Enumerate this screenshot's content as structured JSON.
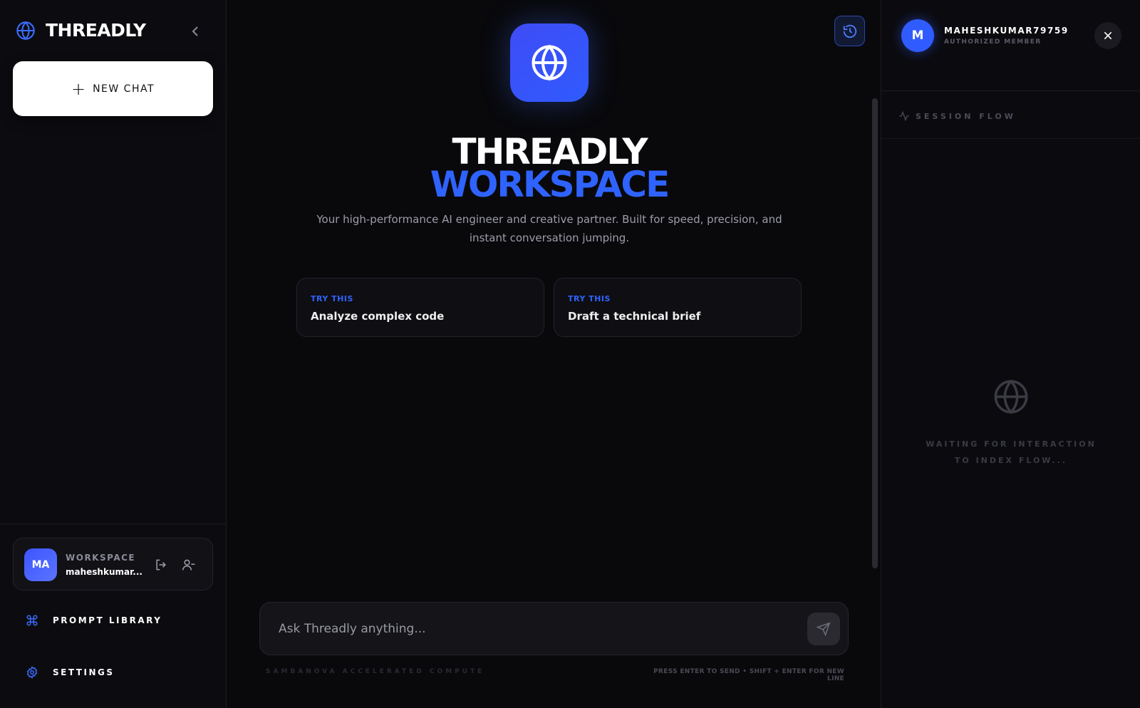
{
  "sidebar": {
    "brand_name": "THREADLY",
    "new_chat_label": "NEW CHAT",
    "workspace": {
      "avatar_initials": "MA",
      "title": "WORKSPACE",
      "user": "maheshkumar..."
    },
    "links": {
      "prompt_library": "PROMPT LIBRARY",
      "settings": "SETTINGS"
    }
  },
  "main": {
    "hero_title_line1": "THREADLY",
    "hero_title_line2": "WORKSPACE",
    "hero_subtitle": "Your high-performance AI engineer and creative partner. Built for speed, precision, and instant conversation jumping.",
    "suggestions": [
      {
        "tag": "TRY THIS",
        "text": "Analyze complex code"
      },
      {
        "tag": "TRY THIS",
        "text": "Draft a technical brief"
      }
    ],
    "composer": {
      "placeholder": "Ask Threadly anything...",
      "value": ""
    },
    "footer_left": "SAMBANOVA ACCELERATED COMPUTE",
    "footer_right": "PRESS ENTER TO SEND • SHIFT + ENTER FOR NEW LINE"
  },
  "right_panel": {
    "avatar_initial": "M",
    "username": "MAHESHKUMAR79759",
    "role": "AUTHORIZED MEMBER",
    "section_title": "SESSION FLOW",
    "empty_line1": "WAITING FOR INTERACTION",
    "empty_line2": "TO INDEX FLOW..."
  },
  "colors": {
    "accent": "#2f63ff",
    "background": "#09090c",
    "panel": "#0c0c10"
  },
  "icons": {
    "brand": "globe-icon",
    "collapse": "chevron-left-icon",
    "new_chat": "plus-icon",
    "logout": "logout-icon",
    "user_minus": "user-minus-icon",
    "prompt_library": "command-icon",
    "settings": "gear-icon",
    "history": "history-icon",
    "send": "send-icon",
    "close": "close-icon",
    "session_flow": "activity-icon"
  }
}
